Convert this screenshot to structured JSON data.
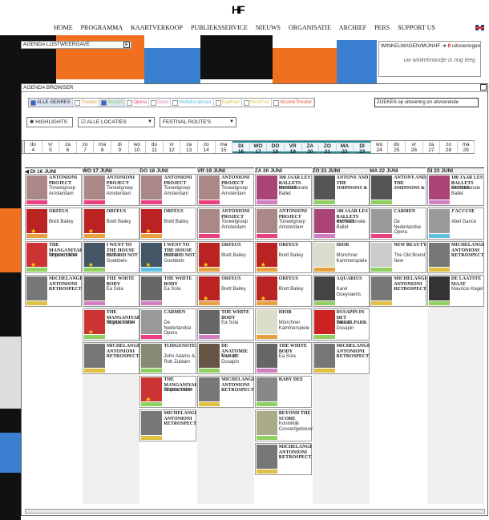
{
  "header": {
    "logo": "HF",
    "nav": [
      "HOME",
      "PROGRAMMA",
      "KAARTVERKOOP",
      "PUBLIEKSSERVICE",
      "NIEUWS",
      "ORGANISATIE",
      "ARCHIEF",
      "PERS",
      "SUPPORT US"
    ]
  },
  "agenda_list": {
    "title": "AGENDA LIJSTWEERGAVE",
    "button": "▸"
  },
  "cart": {
    "title": "WINKELWAGEN/MIJNHF",
    "count": "0",
    "count_label": "uitvoeringen",
    "empty": "uw winkelmandje is nog leeg"
  },
  "browser": {
    "title": "AGENDA BROWSER",
    "genres": [
      {
        "label": "ALLE GENRES",
        "on": true
      },
      {
        "label": "Theater",
        "on": false,
        "color": "#e8a040"
      },
      {
        "label": "Muziek",
        "on": true,
        "color": "#8fd060"
      },
      {
        "label": "Opera",
        "on": false,
        "color": "#e84080"
      },
      {
        "label": "Dans",
        "on": false,
        "color": "#d080c0"
      },
      {
        "label": "Multidisciplinair",
        "on": false,
        "color": "#60c0e0"
      },
      {
        "label": "EyeFuel",
        "on": false,
        "color": "#e0c040"
      },
      {
        "label": "MindFuel",
        "on": false,
        "color": "#e0d060"
      },
      {
        "label": "MuziekTheater",
        "on": false,
        "color": "#e06040"
      }
    ],
    "search": "ZOEKEN op uitvoering en uitvoerende",
    "highlights": "HIGHLIGHTS",
    "locations": "ALLE LOCATIES",
    "routes": "FESTIVAL ROUTE'S",
    "dates": [
      {
        "d": "do",
        "n": "4"
      },
      {
        "d": "vr",
        "n": "5"
      },
      {
        "d": "za",
        "n": "6"
      },
      {
        "d": "zo",
        "n": "7"
      },
      {
        "d": "ma",
        "n": "8"
      },
      {
        "d": "di",
        "n": "9"
      },
      {
        "d": "wo",
        "n": "10"
      },
      {
        "d": "do",
        "n": "11"
      },
      {
        "d": "vr",
        "n": "12"
      },
      {
        "d": "za",
        "n": "13"
      },
      {
        "d": "zo",
        "n": "14"
      },
      {
        "d": "ma",
        "n": "15"
      },
      {
        "d": "DI",
        "n": "16",
        "sel": true
      },
      {
        "d": "WO",
        "n": "17",
        "sel": true
      },
      {
        "d": "DO",
        "n": "18",
        "sel": true
      },
      {
        "d": "VR",
        "n": "19",
        "sel": true
      },
      {
        "d": "ZA",
        "n": "20",
        "sel": true
      },
      {
        "d": "ZO",
        "n": "21",
        "sel": true
      },
      {
        "d": "MA",
        "n": "22",
        "sel": true
      },
      {
        "d": "DI",
        "n": "23",
        "sel": true
      },
      {
        "d": "wo",
        "n": "24"
      },
      {
        "d": "do",
        "n": "25"
      },
      {
        "d": "vr",
        "n": "26"
      },
      {
        "d": "za",
        "n": "27"
      },
      {
        "d": "zo",
        "n": "28"
      },
      {
        "d": "ma",
        "n": "29"
      }
    ],
    "columns": [
      {
        "head": "◀ DI 16 JUNI",
        "tiles": [
          {
            "t": "ANTONIONI PROJECT",
            "s": "Toneelgroep Amsterdam",
            "img": "#a88",
            "bar": "#e84080"
          },
          {
            "t": "ORFEUS",
            "s": "Brett Bailey",
            "img": "#b22",
            "bar": "#e8a040",
            "star": true
          },
          {
            "t": "THE MANGANIYAR SEDUCTION",
            "s": "Roysten Abel",
            "img": "#c33",
            "bar": "#8fd060",
            "star": true
          },
          {
            "t": "MICHELANGELO ANTONIONI RETROSPECTIEF",
            "s": "",
            "img": "#777",
            "bar": "#e0c040"
          }
        ]
      },
      {
        "head": "WO 17 JUNI",
        "tiles": [
          {
            "t": "ANTONIONI PROJECT",
            "s": "Toneelgroep Amsterdam",
            "img": "#a88",
            "bar": "#e84080"
          },
          {
            "t": "ORFEUS",
            "s": "Brett Bailey",
            "img": "#b22",
            "bar": "#e8a040",
            "star": true
          },
          {
            "t": "I WENT TO THE HOUSE BUT DID NOT ENTER",
            "s": "Heiner Goebbels",
            "img": "#456",
            "bar": "#8fd060",
            "star": true
          },
          {
            "t": "THE WHITE BODY",
            "s": "Ea Sola",
            "img": "#666",
            "bar": "#d080c0"
          },
          {
            "t": "THE MANGANIYAR SEDUCTION",
            "s": "Roysten Abel",
            "img": "#c33",
            "bar": "#8fd060",
            "star": true
          },
          {
            "t": "MICHELANGELO ANTONIONI RETROSPECTIEF",
            "s": "",
            "img": "#777",
            "bar": "#e0c040"
          }
        ]
      },
      {
        "head": "DO 18 JUNI",
        "tiles": [
          {
            "t": "ANTONIONI PROJECT",
            "s": "Toneelgroep Amsterdam",
            "img": "#a88",
            "bar": "#e84080"
          },
          {
            "t": "ORFEUS",
            "s": "Brett Bailey",
            "img": "#b22",
            "bar": "#e8a040",
            "star": true
          },
          {
            "t": "I WENT TO THE HOUSE BUT DID NOT ENTER",
            "s": "Heiner Goebbels",
            "img": "#456",
            "bar": "#60c0e0",
            "star": true
          },
          {
            "t": "THE WHITE BODY",
            "s": "Ea Sola",
            "img": "#666",
            "bar": "#d080c0"
          },
          {
            "t": "CARMEN",
            "s": "De Nederlandse Opera",
            "img": "#999",
            "bar": "#e84080"
          },
          {
            "t": "TIJDGENOTEN",
            "s": "John Adams & Rob Zuidam",
            "img": "#887",
            "bar": "#8fd060"
          },
          {
            "t": "THE MANGANIYAR SEDUCTION",
            "s": "Roysten Abel",
            "img": "#c33",
            "bar": "#8fd060",
            "star": true
          },
          {
            "t": "MICHELANGELO ANTONIONI RETROSPECTIEF",
            "s": "",
            "img": "#777",
            "bar": "#e0c040"
          }
        ]
      },
      {
        "head": "VR 19 JUNI",
        "tiles": [
          {
            "t": "ANTONIONI PROJECT",
            "s": "Toneelgroep Amsterdam",
            "img": "#a88",
            "bar": "#e84080"
          },
          {
            "t": "ANTONIONI PROJECT",
            "s": "Toneelgroep Amsterdam",
            "img": "#a88",
            "bar": "#e84080"
          },
          {
            "t": "ORFEUS",
            "s": "Brett Bailey",
            "img": "#b22",
            "bar": "#e8a040",
            "star": true
          },
          {
            "t": "ORFEUS",
            "s": "Brett Bailey",
            "img": "#b22",
            "bar": "#e8a040",
            "star": true
          },
          {
            "t": "THE WHITE BODY",
            "s": "Ea Sola",
            "img": "#666",
            "bar": "#d080c0"
          },
          {
            "t": "DE ANATOMIE VAN DE MELANCHOLIE",
            "s": "Pascal Dusapin",
            "img": "#654",
            "bar": "#8fd060"
          },
          {
            "t": "MICHELANGELO ANTONIONI RETROSPECTIEF",
            "s": "",
            "img": "#777",
            "bar": "#e0c040"
          }
        ]
      },
      {
        "head": "ZA 20 JUNI",
        "tiles": [
          {
            "t": "100 JAAR LES BALLETS RUSSES",
            "s": "Het Nationale Ballet",
            "img": "#a47",
            "bar": "#d080c0"
          },
          {
            "t": "ANTONIONI PROJECT",
            "s": "Toneelgroep Amsterdam",
            "img": "#a88",
            "bar": "#e84080"
          },
          {
            "t": "ORFEUS",
            "s": "Brett Bailey",
            "img": "#b22",
            "bar": "#e8a040",
            "star": true
          },
          {
            "t": "ORFEUS",
            "s": "Brett Bailey",
            "img": "#b22",
            "bar": "#e8a040",
            "star": true
          },
          {
            "t": "HIOB",
            "s": "Münchner Kammerspiele",
            "img": "#ddc",
            "bar": "#e8a040"
          },
          {
            "t": "THE WHITE BODY",
            "s": "Ea Sola",
            "img": "#666",
            "bar": "#d080c0"
          },
          {
            "t": "BABY DEE",
            "s": "",
            "img": "#888",
            "bar": "#8fd060"
          },
          {
            "t": "BEYOND THE SCORE",
            "s": "Koninklijk Concertgebouw",
            "img": "#aa8",
            "bar": "#8fd060"
          },
          {
            "t": "MICHELANGELO ANTONIONI RETROSPECTIEF",
            "s": "",
            "img": "#777",
            "bar": "#e0c040"
          }
        ]
      },
      {
        "head": "ZO 21 JUNI",
        "tiles": [
          {
            "t": "ANTONY AND THE JOHNSONS & METROPOLE ORKEST",
            "s": "",
            "img": "#555",
            "bar": "#8fd060"
          },
          {
            "t": "100 JAAR LES BALLETS RUSSES",
            "s": "Het Nationale Ballet",
            "img": "#a47",
            "bar": "#d080c0"
          },
          {
            "t": "HIOB",
            "s": "Münchner Kammerspiele",
            "img": "#ddc",
            "bar": "#e8a040"
          },
          {
            "t": "AQUARIUS",
            "s": "Karel Goeyvaerts",
            "img": "#444",
            "bar": "#8fd060"
          },
          {
            "t": "DUSAPIN IN HET ORGELPARK",
            "s": "Pascal Dusapin",
            "img": "#c22",
            "bar": "#8fd060"
          },
          {
            "t": "MICHELANGELO ANTONIONI RETROSPECTIEF",
            "s": "",
            "img": "#777",
            "bar": "#e0c040"
          }
        ]
      },
      {
        "head": "MA 22 JUNI",
        "tiles": [
          {
            "t": "ANTONY AND THE JOHNSONS & METROPOLE ORKEST",
            "s": "",
            "img": "#555",
            "bar": "#8fd060"
          },
          {
            "t": "CARMEN",
            "s": "De Nederlandse Opera",
            "img": "#999",
            "bar": "#e84080"
          },
          {
            "t": "NEW BEAUTY",
            "s": "The Old Brand New",
            "img": "#ccc",
            "bar": "#8fd060"
          },
          {
            "t": "MICHELANGELO ANTONIONI RETROSPECTIEF",
            "s": "",
            "img": "#777",
            "bar": "#e0c040"
          }
        ]
      },
      {
        "head": "DI 23 JUNI",
        "tiles": [
          {
            "t": "100 JAAR LES BALLETS RUSSES",
            "s": "Het Nationale Ballet",
            "img": "#a47",
            "bar": "#d080c0"
          },
          {
            "t": "J'ACCUSE",
            "s": "Abel Gance",
            "img": "#999",
            "bar": "#60c0e0"
          },
          {
            "t": "MICHELANGELO ANTONIONI RETROSPECTIEF",
            "s": "",
            "img": "#777",
            "bar": "#e0c040"
          },
          {
            "t": "DE LAATSTE MAAT",
            "s": "Mauricio Kagel",
            "img": "#333",
            "bar": "#8fd060"
          }
        ]
      }
    ]
  }
}
